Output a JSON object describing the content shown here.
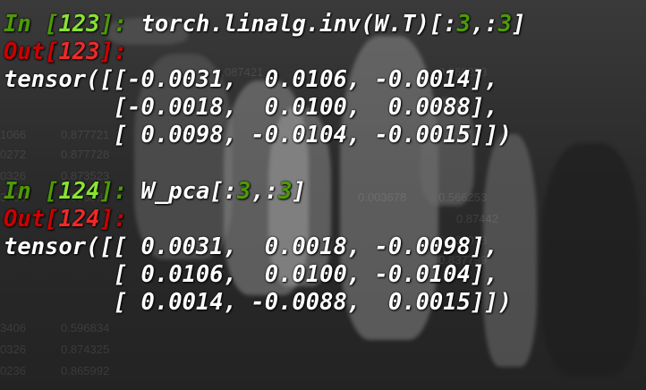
{
  "colors": {
    "in_prompt": "#4e9a06",
    "in_prompt_number": "#8ae234",
    "out_prompt": "#cc0000",
    "out_prompt_number": "#ef2929",
    "code_text": "#ffffff",
    "code_number": "#4e9a06"
  },
  "cells": [
    {
      "in_label": "In",
      "in_number": "123",
      "code_pre": "torch.linalg.inv(W.T)[:",
      "code_n1": "3",
      "code_mid": ",:",
      "code_n2": "3",
      "code_post": "]",
      "out_label": "Out",
      "out_number": "123",
      "output_lines": [
        "tensor([[-0.0031,  0.0106, -0.0014],",
        "        [-0.0018,  0.0100,  0.0088],",
        "        [ 0.0098, -0.0104, -0.0015]])"
      ]
    },
    {
      "in_label": "In",
      "in_number": "124",
      "code_pre": "W_pca[:",
      "code_n1": "3",
      "code_mid": ",:",
      "code_n2": "3",
      "code_post": "]",
      "out_label": "Out",
      "out_number": "124",
      "output_lines": [
        "tensor([[ 0.0031,  0.0018, -0.0098],",
        "        [ 0.0106,  0.0100, -0.0104],",
        "        [ 0.0014, -0.0088,  0.0015]])"
      ]
    }
  ]
}
